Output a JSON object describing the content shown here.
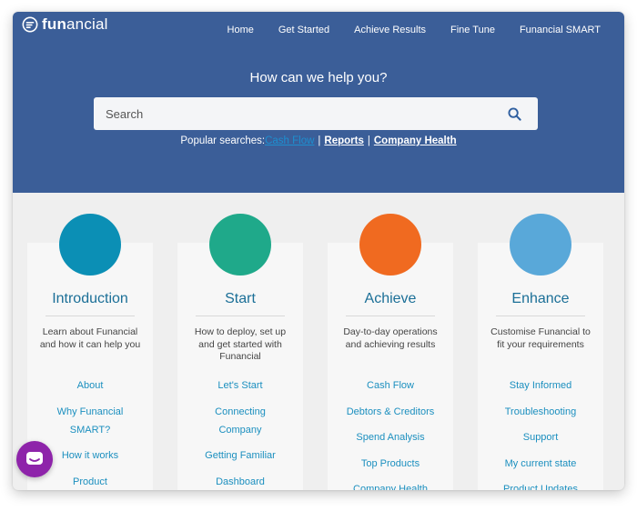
{
  "brand": {
    "logo_prefix": "fun",
    "logo_suffix": "ancial"
  },
  "nav": [
    {
      "label": "Home"
    },
    {
      "label": "Get Started"
    },
    {
      "label": "Achieve Results"
    },
    {
      "label": "Fine Tune"
    },
    {
      "label": "Funancial SMART"
    }
  ],
  "hero": {
    "title": "How can we help you?",
    "search_placeholder": "Search",
    "popular_label": "Popular searches:",
    "popular": [
      "Cash Flow",
      "Reports",
      "Company Health"
    ]
  },
  "cards": [
    {
      "title": "Introduction",
      "color": "#0b8fb5",
      "description": "Learn about Funancial and how it can help you",
      "links": [
        "About",
        "Why Funancial SMART?",
        "How it works",
        "Product"
      ]
    },
    {
      "title": "Start",
      "color": "#1fa98a",
      "description": "How to deploy, set up and get started with Funancial",
      "links": [
        "Let's Start",
        "Connecting Company",
        "Getting Familiar",
        "Dashboard"
      ]
    },
    {
      "title": "Achieve",
      "color": "#f06a20",
      "description": "Day-to-day operations and achieving results",
      "links": [
        "Cash Flow",
        "Debtors & Creditors",
        "Spend Analysis",
        "Top Products",
        "Company Health"
      ]
    },
    {
      "title": "Enhance",
      "color": "#59a8d9",
      "description": "Customise Funancial to fit your requirements",
      "links": [
        "Stay Informed",
        "Troubleshooting",
        "Support",
        "My current state",
        "Product Updates"
      ]
    }
  ],
  "colors": {
    "header": "#3b5e98",
    "accent_line": "#2a86b0",
    "link": "#1b8fbf",
    "chat": "#8e24aa"
  },
  "icons": {
    "search": "search-icon",
    "chat": "chat-icon"
  }
}
